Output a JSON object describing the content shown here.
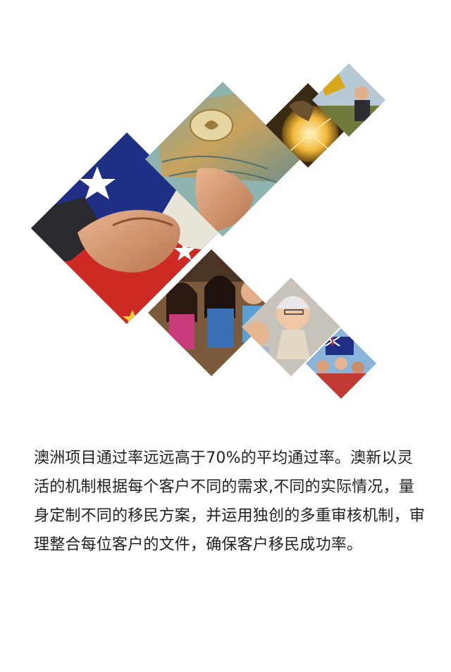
{
  "article": {
    "paragraph": "澳洲项目通过率远远高于70%的平均通过率。澳新以灵活的机制根据每个客户不同的需求,不同的实际情况，量身定制不同的移民方案，并运用独创的多重审核机制，审理整合每位客户的文件，确保客户移民成功率。"
  },
  "collage": {
    "tiles": [
      {
        "name": "flag-handshake-photo",
        "depicts": "handshake over Australian and Chinese flags"
      },
      {
        "name": "currency-photo",
        "depicts": "hand holding Australian dollar notes"
      },
      {
        "name": "welder-photo",
        "depicts": "tradesman welding with sparks"
      },
      {
        "name": "farm-photo",
        "depicts": "farm workers and graduate"
      },
      {
        "name": "students-photo",
        "depicts": "smiling students in a library"
      },
      {
        "name": "seniors-photo",
        "depicts": "smiling elderly couple"
      },
      {
        "name": "crowd-flags-photo",
        "depicts": "crowd waving Australian flags"
      }
    ]
  },
  "colors": {
    "background": "#ffffff",
    "text": "#222222",
    "flag_blue": "#1f2f86",
    "flag_red": "#cc2a22",
    "gold": "#d9a71a"
  }
}
